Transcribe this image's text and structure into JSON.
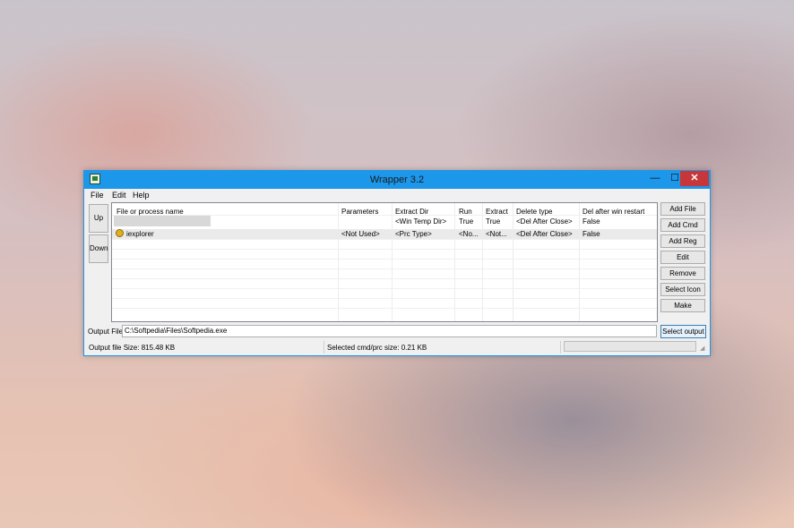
{
  "window": {
    "title": "Wrapper 3.2",
    "minimize_glyph": "—",
    "maximize_glyph": "☐",
    "close_glyph": "✕"
  },
  "menu": [
    "File",
    "Edit",
    "Help"
  ],
  "side_buttons": {
    "up": "Up",
    "down": "Down"
  },
  "table": {
    "columns": [
      "File or process name",
      "Parameters",
      "Extract Dir",
      "Run",
      "Extract",
      "Delete type",
      "Del after win restart"
    ],
    "rows": [
      {
        "name": "",
        "parameters": "",
        "extract_dir": "<Win Temp Dir>",
        "run": "True",
        "extract": "True",
        "delete_type": "<Del After Close>",
        "del_after_restart": "False"
      },
      {
        "name": "iexplorer",
        "parameters": "<Not Used>",
        "extract_dir": "<Prc Type>",
        "run": "<No...",
        "extract": "<Not...",
        "delete_type": "<Del After Close>",
        "del_after_restart": "False"
      }
    ]
  },
  "action_buttons": [
    "Add File",
    "Add Cmd",
    "Add Reg",
    "Edit",
    "Remove",
    "Select Icon",
    "Make"
  ],
  "output": {
    "label": "Output File:",
    "value": "C:\\Softpedia\\Files\\Softpedia.exe",
    "button": "Select output"
  },
  "status": {
    "output_size": "Output file Size: 815.48 KB",
    "selected_size": "Selected cmd/prc size: 0.21 KB"
  },
  "colors": {
    "title_bar": "#1c97ea",
    "close_button": "#c7373a"
  }
}
